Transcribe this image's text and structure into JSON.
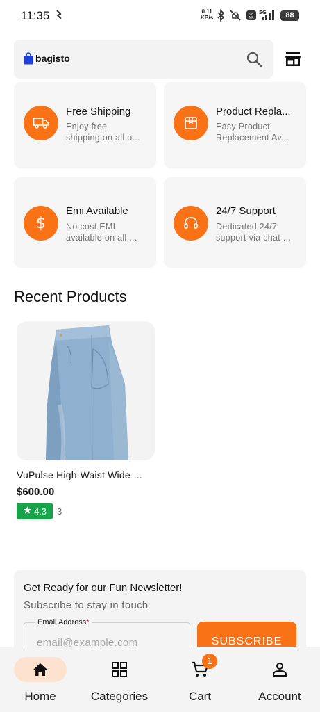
{
  "status_bar": {
    "time": "11:35",
    "net_speed_value": "0.11",
    "net_speed_unit": "KB/s",
    "battery": "88",
    "icons": [
      "bluetooth-icon",
      "mute-icon",
      "volte-icon",
      "signal-5g-icon",
      "battery-icon"
    ]
  },
  "header": {
    "logo_text": "bagisto",
    "search_icon": "search-icon",
    "store_icon": "store-icon"
  },
  "features": [
    {
      "title": "Free Shipping",
      "desc_line1": "Enjoy free",
      "desc_line2": "shipping on all o...",
      "icon": "truck-icon"
    },
    {
      "title": "Product Repla...",
      "desc_line1": "Easy Product",
      "desc_line2": "Replacement Av...",
      "icon": "box-icon"
    },
    {
      "title": "Emi Available",
      "desc_line1": "No cost EMI",
      "desc_line2": "available on all ...",
      "icon": "dollar-icon"
    },
    {
      "title": "24/7 Support",
      "desc_line1": "Dedicated 24/7",
      "desc_line2": "support via chat ...",
      "icon": "headphones-icon"
    }
  ],
  "recent": {
    "title": "Recent Products",
    "products": [
      {
        "name": "VuPulse High-Waist Wide-...",
        "price": "$600.00",
        "rating": "4.3",
        "rating_count": "3"
      }
    ]
  },
  "newsletter": {
    "title": "Get Ready for our Fun Newsletter!",
    "subtitle": "Subscribe to stay in touch",
    "email_label": "Email Address",
    "email_required_mark": "*",
    "email_placeholder": "email@example.com",
    "button_label": "SUBSCRIBE"
  },
  "bottom_nav": {
    "items": [
      {
        "label": "Home",
        "icon": "home-icon",
        "active": true
      },
      {
        "label": "Categories",
        "icon": "grid-icon",
        "active": false
      },
      {
        "label": "Cart",
        "icon": "cart-icon",
        "active": false,
        "badge": "1"
      },
      {
        "label": "Account",
        "icon": "person-icon",
        "active": false
      }
    ]
  },
  "colors": {
    "accent": "#f97316",
    "rating_green": "#16a34a",
    "card_bg": "#f5f5f5",
    "active_nav_bg": "#fde2cf"
  }
}
